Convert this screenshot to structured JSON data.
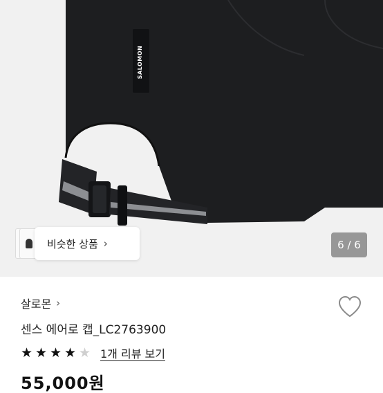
{
  "gallery": {
    "similar_label": "비슷한 상품",
    "similar_chevron": "›",
    "counter": "6 / 6",
    "tag_text": "SALOMON"
  },
  "product": {
    "brand": "살로몬",
    "brand_chevron": "›",
    "title": "센스 에어로 캡_LC2763900",
    "rating": 4,
    "rating_max": 5,
    "review_link": "1개 리뷰 보기",
    "price_partial": "55,000원"
  },
  "colors": {
    "background": "#ffffff",
    "image_bg": "#f1f1f1",
    "cap": "#1d1e20",
    "counter_bg": "#7a7a7a",
    "star_on": "#111111",
    "star_off": "#cfcfcf"
  },
  "icons": {
    "wishlist": "heart-outline-icon",
    "star": "star-icon",
    "chevron": "chevron-right-icon"
  }
}
